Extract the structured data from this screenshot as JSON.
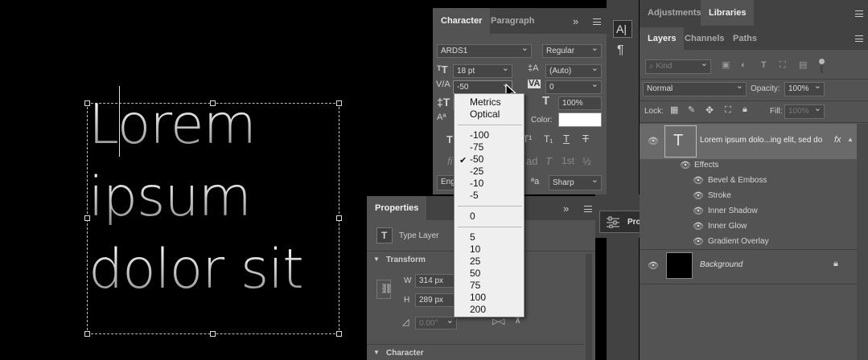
{
  "canvas": {
    "lines": [
      "Lorem",
      "ipsum",
      "dolor sit"
    ]
  },
  "character_panel": {
    "tabs": [
      "Character",
      "Paragraph"
    ],
    "expand_glyph": "»",
    "font_family": "ARDS1",
    "font_style": "Regular",
    "font_size": "18 pt",
    "leading": "(Auto)",
    "kerning": "-50",
    "tracking": "0",
    "vertical_scale_partial": "",
    "horizontal_scale": "100%",
    "color_label": "Color:",
    "language_partial": "Eng",
    "antialias": "Sharp",
    "aa_icon": "ªa",
    "style_buttons": [
      "T",
      "T",
      "T",
      "T",
      "T¹",
      "T₁",
      "T",
      "T"
    ],
    "opentype_buttons": [
      "fi",
      "ơ",
      "st",
      "A",
      "ad",
      "T",
      "1st",
      "½"
    ]
  },
  "kerning_dropdown": {
    "options_top": [
      "Metrics",
      "Optical"
    ],
    "options_mid": [
      "-100",
      "-75",
      "-50",
      "-25",
      "-10",
      "-5"
    ],
    "options_zero": [
      "0"
    ],
    "options_pos": [
      "5",
      "10",
      "25",
      "50",
      "75",
      "100",
      "200"
    ],
    "selected": "-50",
    "check_glyph": "✔"
  },
  "tools_strip": {
    "character_icon_glyph": "A|",
    "paragraph_icon_glyph": "¶"
  },
  "properties_panel": {
    "tab": "Properties",
    "expand_glyph": "»",
    "layer_type": "Type Layer",
    "transform_section": "Transform",
    "w_label": "W",
    "w_value": "314 px",
    "h_label": "H",
    "h_value": "289 px",
    "angle_value": "0.00°",
    "character_section": "Character"
  },
  "properties_flyout": {
    "label": "Properties",
    "close_glyph": "×",
    "expand_glyph": "»"
  },
  "adjustments_panel": {
    "tabs": [
      "Adjustments",
      "Libraries"
    ]
  },
  "layers_panel": {
    "tabs": [
      "Layers",
      "Channels",
      "Paths"
    ],
    "kind_filter": "Kind",
    "blend_mode": "Normal",
    "opacity_label": "Opacity:",
    "opacity_value": "100%",
    "lock_label": "Lock:",
    "fill_label": "Fill:",
    "fill_value": "100%",
    "text_layer_name": "Lorem ipsum dolo...ing elit, sed do",
    "fx_label": "fx",
    "effects_label": "Effects",
    "effects": [
      "Bevel & Emboss",
      "Stroke",
      "Inner Shadow",
      "Inner Glow",
      "Gradient Overlay"
    ],
    "background_layer_name": "Background"
  },
  "colors": {
    "panel_bg": "#535353",
    "tabbar_bg": "#424242",
    "selected_layer": "#6a6a6a",
    "dropdown_bg": "#efefef"
  }
}
